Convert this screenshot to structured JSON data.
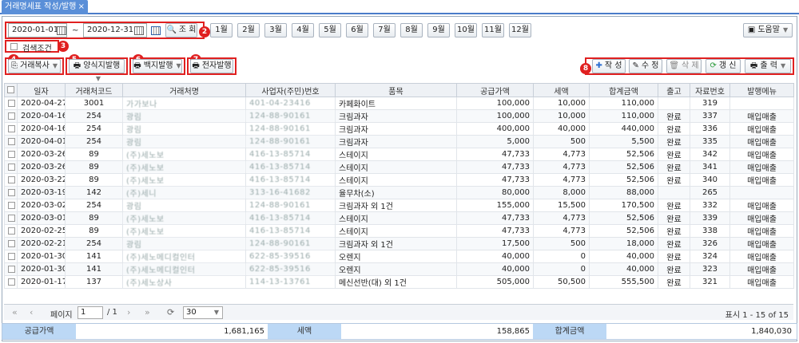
{
  "tab": {
    "title": "거래명세표 작성/발행",
    "close": "×"
  },
  "filters": {
    "date_from": "2020-01-01",
    "date_to": "2020-12-31",
    "tilde": "~",
    "search_label": "조 회",
    "months": [
      "1월",
      "2월",
      "3월",
      "4월",
      "5월",
      "6월",
      "7월",
      "8월",
      "9월",
      "10월",
      "11월",
      "12월"
    ],
    "help_label": "도움말",
    "search_condition_label": "검색조건"
  },
  "callouts": [
    "2",
    "3",
    "4",
    "5",
    "6",
    "7",
    "8"
  ],
  "toolbar": {
    "copy_label": "거래복사",
    "form_issue_label": "양식지발행",
    "blank_issue_label": "백지발행",
    "e_issue_label": "전자발행",
    "create_label": "작 성",
    "edit_label": "수 정",
    "delete_label": "삭 제",
    "refresh_label": "갱 신",
    "print_label": "출 력"
  },
  "table": {
    "headers": [
      "일자",
      "거래처코드",
      "거래처명",
      "사업자(주민)번호",
      "품목",
      "공급가액",
      "세액",
      "합계금액",
      "출고",
      "자료번호",
      "발행메뉴"
    ],
    "rows": [
      {
        "date": "2020-04-27",
        "code": "3001",
        "name": "가가보나",
        "bizno": "401-04-23416",
        "item": "카페화이트",
        "supply": "100,000",
        "tax": "10,000",
        "total": "110,000",
        "out": "",
        "no": "319",
        "menu": ""
      },
      {
        "date": "2020-04-16",
        "code": "254",
        "name": "광림",
        "bizno": "124-88-90161",
        "item": "크림과자",
        "supply": "100,000",
        "tax": "10,000",
        "total": "110,000",
        "out": "완료",
        "no": "337",
        "menu": "매입매출"
      },
      {
        "date": "2020-04-16",
        "code": "254",
        "name": "광림",
        "bizno": "124-88-90161",
        "item": "크림과자",
        "supply": "400,000",
        "tax": "40,000",
        "total": "440,000",
        "out": "완료",
        "no": "336",
        "menu": "매입매출"
      },
      {
        "date": "2020-04-01",
        "code": "254",
        "name": "광림",
        "bizno": "124-88-90161",
        "item": "크림과자",
        "supply": "5,000",
        "tax": "500",
        "total": "5,500",
        "out": "완료",
        "no": "335",
        "menu": "매입매출"
      },
      {
        "date": "2020-03-26",
        "code": "89",
        "name": "(주)세노보",
        "bizno": "416-13-85714",
        "item": "스테이지",
        "supply": "47,733",
        "tax": "4,773",
        "total": "52,506",
        "out": "완료",
        "no": "342",
        "menu": "매입매출"
      },
      {
        "date": "2020-03-26",
        "code": "89",
        "name": "(주)세노보",
        "bizno": "416-13-85714",
        "item": "스테이지",
        "supply": "47,733",
        "tax": "4,773",
        "total": "52,506",
        "out": "완료",
        "no": "341",
        "menu": "매입매출"
      },
      {
        "date": "2020-03-22",
        "code": "89",
        "name": "(주)세노보",
        "bizno": "416-13-85714",
        "item": "스테이지",
        "supply": "47,733",
        "tax": "4,773",
        "total": "52,506",
        "out": "완료",
        "no": "340",
        "menu": "매입매출"
      },
      {
        "date": "2020-03-19",
        "code": "142",
        "name": "(주)세니",
        "bizno": "313-16-41682",
        "item": "율무차(소)",
        "supply": "80,000",
        "tax": "8,000",
        "total": "88,000",
        "out": "",
        "no": "265",
        "menu": ""
      },
      {
        "date": "2020-03-02",
        "code": "254",
        "name": "광림",
        "bizno": "124-88-90161",
        "item": "크림과자 외 1건",
        "supply": "155,000",
        "tax": "15,500",
        "total": "170,500",
        "out": "완료",
        "no": "332",
        "menu": "매입매출"
      },
      {
        "date": "2020-03-01",
        "code": "89",
        "name": "(주)세노보",
        "bizno": "416-13-85714",
        "item": "스테이지",
        "supply": "47,733",
        "tax": "4,773",
        "total": "52,506",
        "out": "완료",
        "no": "339",
        "menu": "매입매출"
      },
      {
        "date": "2020-02-25",
        "code": "89",
        "name": "(주)세노보",
        "bizno": "416-13-85714",
        "item": "스테이지",
        "supply": "47,733",
        "tax": "4,773",
        "total": "52,506",
        "out": "완료",
        "no": "338",
        "menu": "매입매출"
      },
      {
        "date": "2020-02-21",
        "code": "254",
        "name": "광림",
        "bizno": "124-88-90161",
        "item": "크림과자 외 1건",
        "supply": "17,500",
        "tax": "500",
        "total": "18,000",
        "out": "완료",
        "no": "326",
        "menu": "매입매출"
      },
      {
        "date": "2020-01-30",
        "code": "141",
        "name": "(주)세노메디컬인터",
        "bizno": "622-85-39516",
        "item": "오렌지",
        "supply": "40,000",
        "tax": "0",
        "total": "40,000",
        "out": "완료",
        "no": "324",
        "menu": "매입매출"
      },
      {
        "date": "2020-01-30",
        "code": "141",
        "name": "(주)세노메디컬인터",
        "bizno": "622-85-39516",
        "item": "오렌지",
        "supply": "40,000",
        "tax": "0",
        "total": "40,000",
        "out": "완료",
        "no": "323",
        "menu": "매입매출"
      },
      {
        "date": "2020-01-17",
        "code": "137",
        "name": "(주)세노상사",
        "bizno": "114-13-13761",
        "item": "메신선반(대) 외 1건",
        "supply": "505,000",
        "tax": "50,500",
        "total": "555,500",
        "out": "완료",
        "no": "321",
        "menu": "매입매출"
      }
    ]
  },
  "pager": {
    "page_label": "페이지",
    "page_value": "1",
    "total_pages": "/ 1",
    "page_size": "30",
    "display_text": "표시 1 - 15 of 15"
  },
  "summary": {
    "supply_label": "공급가액",
    "supply_value": "1,681,165",
    "tax_label": "세액",
    "tax_value": "158,865",
    "total_label": "합계금액",
    "total_value": "1,840,030"
  }
}
